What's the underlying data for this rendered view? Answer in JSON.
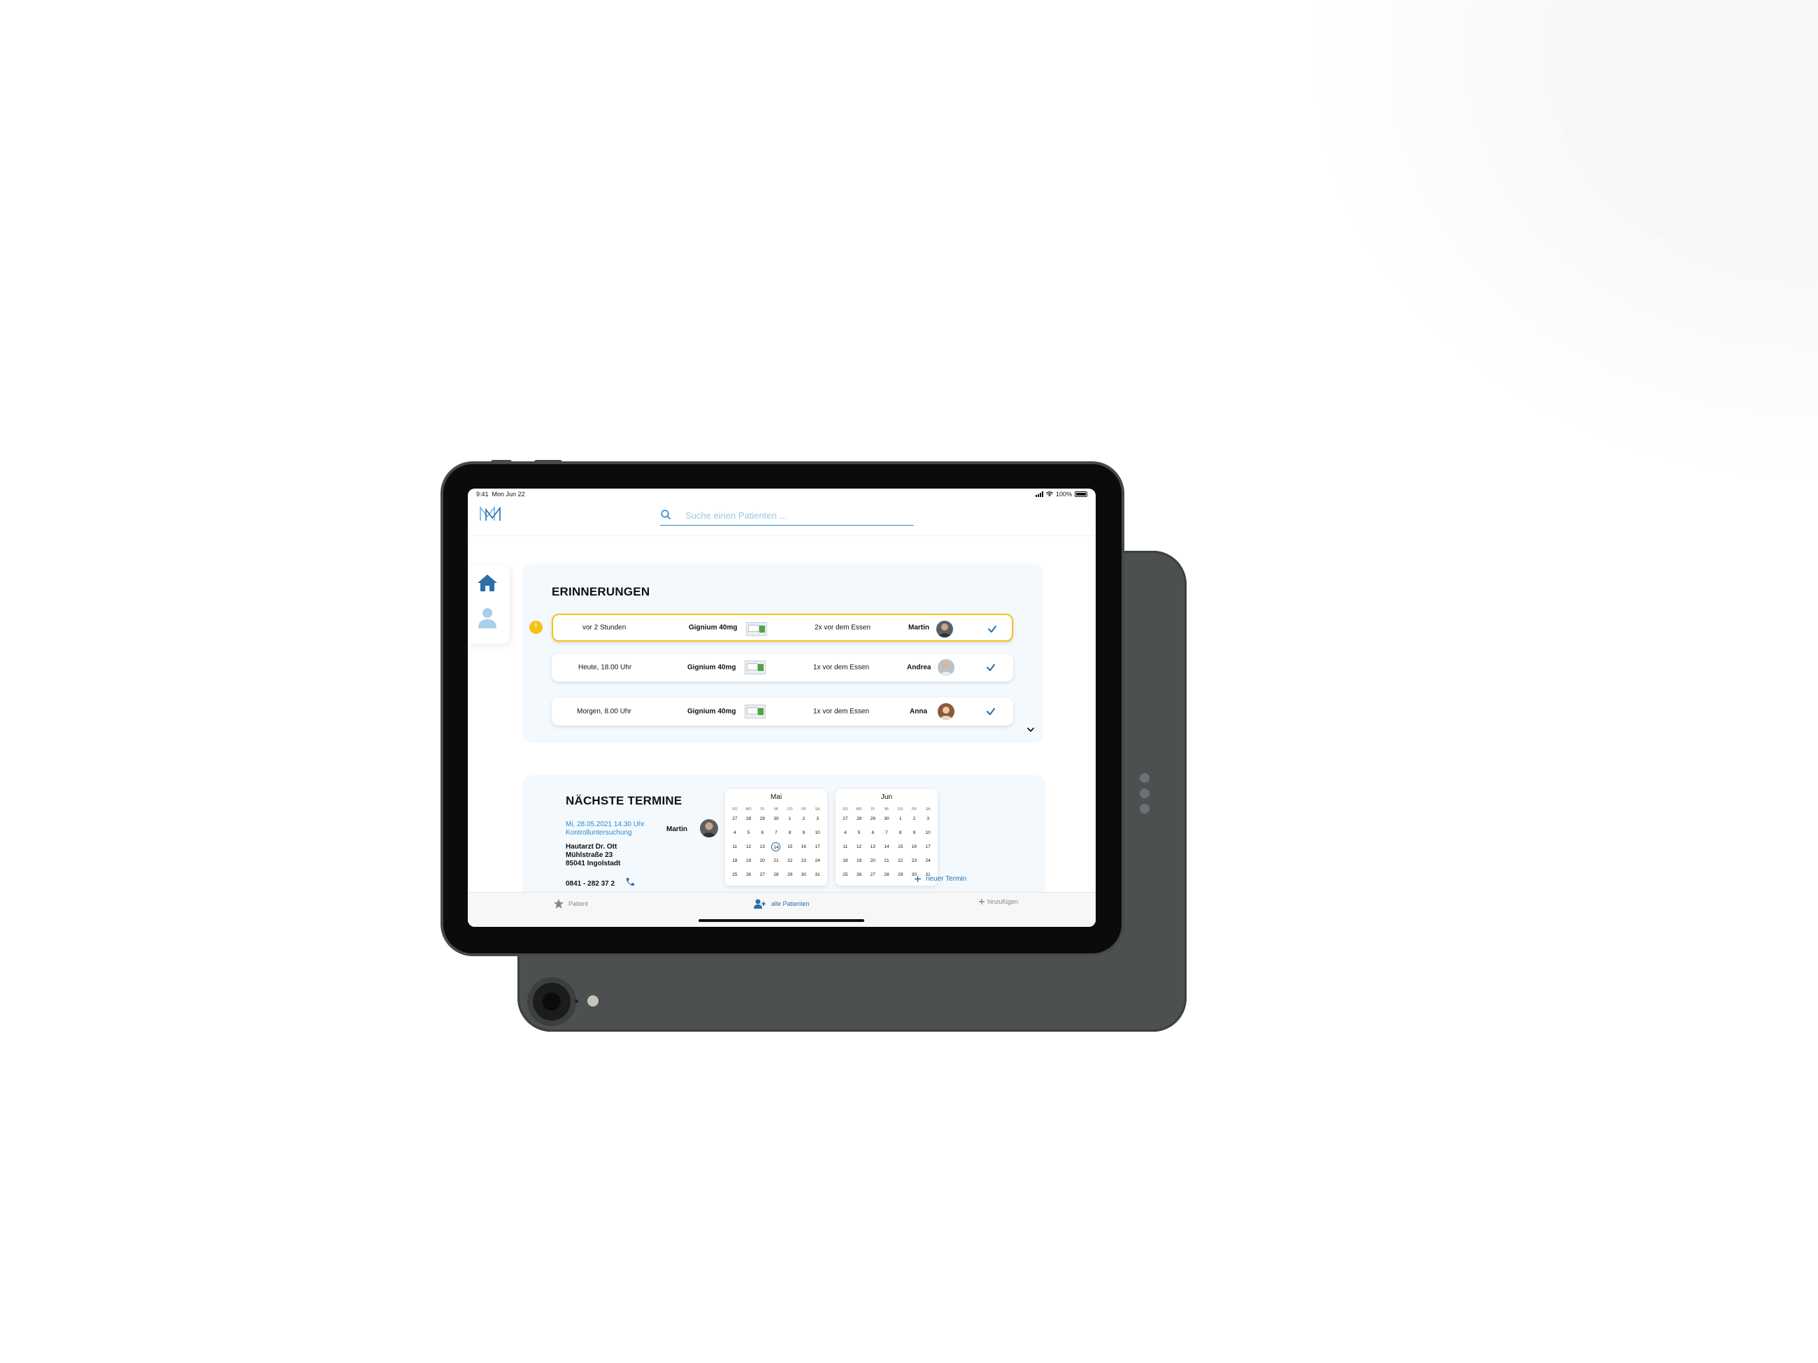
{
  "status_bar": {
    "time": "9:41",
    "date": "Mon Jun 22",
    "battery": "100%"
  },
  "header": {
    "logo_icon": "m-logo-icon",
    "search": {
      "placeholder": "Suche einen Patienten ...",
      "value": ""
    }
  },
  "sidenav": {
    "items": [
      {
        "icon": "home-icon",
        "active": true
      },
      {
        "icon": "person-icon",
        "active": false
      }
    ]
  },
  "reminders": {
    "title": "ERINNERUNGEN",
    "alert_badge": "!",
    "rows": [
      {
        "time": "vor 2 Stunden",
        "medication": "Gignium 40mg",
        "dosage": "2x vor dem Essen",
        "patient": "Martin",
        "highlighted": true
      },
      {
        "time": "Heute, 18.00 Uhr",
        "medication": "Gignium 40mg",
        "dosage": "1x vor dem Essen",
        "patient": "Andrea",
        "highlighted": false
      },
      {
        "time": "Morgen, 8.00 Uhr",
        "medication": "Gignium 40mg",
        "dosage": "1x vor dem Essen",
        "patient": "Anna",
        "highlighted": false
      }
    ]
  },
  "appointments": {
    "title": "NÄCHSTE TERMINE",
    "date": "Mi, 28.05.2021 14.30 Uhr",
    "type": "Kontrolluntersuchung",
    "patient": "Martin",
    "address_lines": [
      "Hautarzt Dr. Ott",
      "Mühlstraße 23",
      "85041 Ingolstadt"
    ],
    "phone": "0841 - 282 37 2",
    "new_appointment": "neuer Termin",
    "calendars": [
      {
        "month": "Mai",
        "weekdays": [
          "SO",
          "MO",
          "DI",
          "MI",
          "DO",
          "FR",
          "SA"
        ],
        "days": [
          "27",
          "28",
          "29",
          "30",
          "1",
          "2",
          "3",
          "4",
          "5",
          "6",
          "7",
          "8",
          "9",
          "10",
          "11",
          "12",
          "13",
          "14",
          "15",
          "16",
          "17",
          "18",
          "19",
          "20",
          "21",
          "22",
          "23",
          "24",
          "25",
          "26",
          "27",
          "28",
          "29",
          "30",
          "31"
        ],
        "selected": "14"
      },
      {
        "month": "Jun",
        "weekdays": [
          "SO",
          "MO",
          "DI",
          "MI",
          "DO",
          "FR",
          "SA"
        ],
        "days": [
          "27",
          "28",
          "29",
          "30",
          "1",
          "2",
          "3",
          "4",
          "5",
          "6",
          "7",
          "8",
          "9",
          "10",
          "11",
          "12",
          "13",
          "14",
          "15",
          "16",
          "17",
          "18",
          "19",
          "20",
          "21",
          "22",
          "23",
          "24",
          "25",
          "26",
          "27",
          "28",
          "29",
          "30",
          "31"
        ],
        "selected": ""
      }
    ]
  },
  "tabbar": {
    "tabs": [
      {
        "label": "Patient",
        "icon": "star-icon",
        "active": false
      },
      {
        "label": "alle Patienten",
        "icon": "patients-icon",
        "active": true
      },
      {
        "label": "hinzufügen",
        "icon": "plus-icon",
        "active": false
      }
    ]
  },
  "colors": {
    "accent": "#2a8bd1",
    "highlight": "#f3c316",
    "card_bg": "#f4f9fd",
    "nav_blue": "#2a6fa8"
  }
}
